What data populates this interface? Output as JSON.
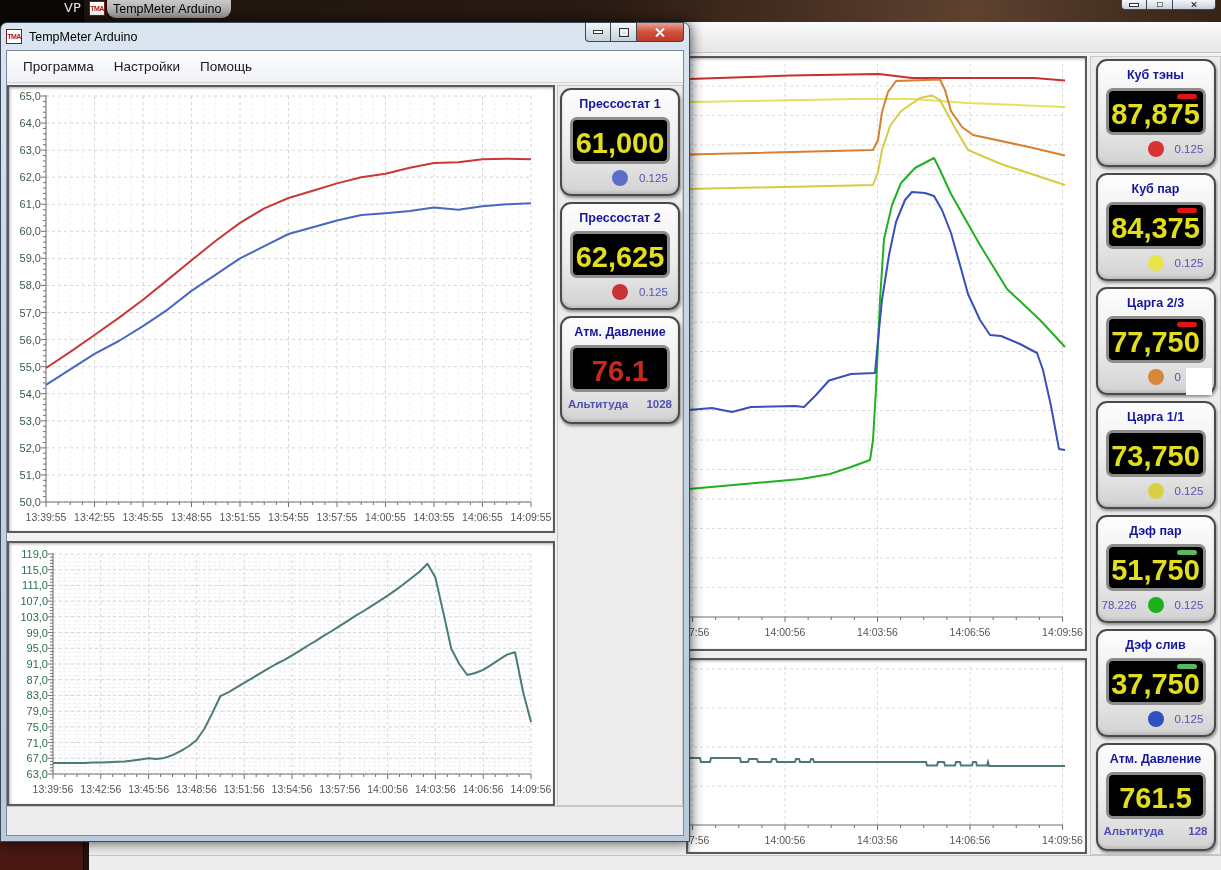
{
  "desktop": {
    "label": "VP"
  },
  "background_window": {
    "icon_text": "TMA",
    "title": "TempMeter Arduino",
    "upper_chart": {
      "x_labels": [
        "7:56",
        "14:00:56",
        "14:03:56",
        "14:06:56",
        "14:09:56"
      ]
    },
    "lower_chart": {
      "x_labels": [
        "7:56",
        "14:00:56",
        "14:03:56",
        "14:06:56",
        "14:09:56"
      ]
    },
    "gauges": [
      {
        "kind": "temperature",
        "title": "Куб тэны",
        "value": "87,875",
        "alarm": false,
        "indicator": {
          "color": "#e01414"
        },
        "color": "#d83232",
        "step": "0.125",
        "masked": false
      },
      {
        "kind": "temperature",
        "title": "Куб пар",
        "value": "84,375",
        "alarm": false,
        "indicator": {
          "color": "#e01414"
        },
        "color": "#e8e44a",
        "step": "0.125",
        "masked": false
      },
      {
        "kind": "temperature",
        "title": "Царга 2/3",
        "value": "77,750",
        "alarm": false,
        "indicator": {
          "color": "#e01414"
        },
        "color": "#d8863a",
        "step": "0",
        "masked": true
      },
      {
        "kind": "temperature",
        "title": "Царга 1/1",
        "value": "73,750",
        "alarm": false,
        "color": "#d8d044",
        "step": "0.125",
        "masked": false
      },
      {
        "kind": "temperature",
        "title": "Дэф пар",
        "value": "51,750",
        "alarm": false,
        "indicator": {
          "color": "#5cb85c"
        },
        "reading": "78.226",
        "color": "#1cb01c",
        "step": "0.125",
        "masked": false
      },
      {
        "kind": "temperature",
        "title": "Дэф слив",
        "value": "37,750",
        "alarm": false,
        "indicator": {
          "color": "#5cb85c"
        },
        "color": "#3050c0",
        "step": "0.125",
        "masked": false
      },
      {
        "kind": "pressure",
        "title": "Атм. Давление",
        "value": "761.5",
        "alarm": false,
        "caption": "Альтитуда",
        "altitude": "128"
      }
    ]
  },
  "window": {
    "icon_text": "TMA",
    "title": "TempMeter Arduino",
    "menu": [
      "Программа",
      "Настройки",
      "Помощь"
    ],
    "charts": [
      {
        "chart_data": {
          "type": "line",
          "grid": true,
          "categories": [
            "13:39:55",
            null,
            "13:42:55",
            null,
            "13:45:55",
            null,
            "13:48:55",
            null,
            "13:51:55",
            null,
            "13:54:55",
            null,
            "13:57:55",
            null,
            "14:00:55",
            null,
            "14:03:55",
            null,
            "14:06:55",
            null,
            "14:09:55"
          ],
          "ylim": [
            50,
            65
          ],
          "yticks": [
            {
              "value": 50,
              "label": "50,0"
            },
            {
              "value": 51,
              "label": "51,0"
            },
            {
              "value": 52,
              "label": "52,0"
            },
            {
              "value": 53,
              "label": "53,0"
            },
            {
              "value": 54,
              "label": "54,0"
            },
            {
              "value": 55,
              "label": "55,0"
            },
            {
              "value": 56,
              "label": "56,0"
            },
            {
              "value": 57,
              "label": "57,0"
            },
            {
              "value": 58,
              "label": "58,0"
            },
            {
              "value": 59,
              "label": "59,0"
            },
            {
              "value": 60,
              "label": "60,0"
            },
            {
              "value": 61,
              "label": "61,0"
            },
            {
              "value": 62,
              "label": "62,0"
            },
            {
              "value": 63,
              "label": "63,0"
            },
            {
              "value": 64,
              "label": "64,0"
            },
            {
              "value": 65,
              "label": "65,0"
            }
          ],
          "series": [
            {
              "color": "#c83838",
              "values": [
                54.95,
                55.55,
                56.17,
                56.8,
                57.47,
                58.2,
                58.93,
                59.65,
                60.31,
                60.85,
                61.23,
                61.5,
                61.77,
                62.0,
                62.13,
                62.35,
                62.53,
                62.55,
                62.66,
                62.68,
                62.66
              ]
            },
            {
              "color": "#4868c0",
              "values": [
                54.33,
                54.9,
                55.47,
                55.95,
                56.5,
                57.1,
                57.8,
                58.4,
                59.0,
                59.45,
                59.9,
                60.15,
                60.4,
                60.6,
                60.67,
                60.75,
                60.88,
                60.8,
                60.93,
                61.0,
                61.04
              ]
            }
          ]
        }
      },
      {
        "chart_data": {
          "type": "line",
          "grid": true,
          "categories": [
            "13:39:56",
            null,
            null,
            null,
            null,
            null,
            "13:42:56",
            null,
            null,
            null,
            null,
            null,
            "13:45:56",
            null,
            null,
            null,
            null,
            null,
            "13:48:56",
            null,
            null,
            null,
            null,
            null,
            "13:51:56",
            null,
            null,
            null,
            null,
            null,
            "13:54:56",
            null,
            null,
            null,
            null,
            null,
            "13:57:56",
            null,
            null,
            null,
            null,
            null,
            "14:00:56",
            null,
            null,
            null,
            null,
            null,
            "14:03:56",
            null,
            null,
            null,
            null,
            null,
            "14:06:56",
            null,
            null,
            null,
            null,
            null,
            "14:09:56"
          ],
          "ylim": [
            63,
            119
          ],
          "yticks": [
            {
              "value": 63,
              "label": "63,0"
            },
            {
              "value": 67,
              "label": "67,0"
            },
            {
              "value": 71,
              "label": "71,0"
            },
            {
              "value": 75,
              "label": "75,0"
            },
            {
              "value": 79,
              "label": "79,0"
            },
            {
              "value": 83,
              "label": "83,0"
            },
            {
              "value": 87,
              "label": "87,0"
            },
            {
              "value": 91,
              "label": "91,0"
            },
            {
              "value": 95,
              "label": "95,0"
            },
            {
              "value": 99,
              "label": "99,0"
            },
            {
              "value": 103,
              "label": "103,0"
            },
            {
              "value": 107,
              "label": "107,0"
            },
            {
              "value": 111,
              "label": "111,0"
            },
            {
              "value": 115,
              "label": "115,0"
            },
            {
              "value": 119,
              "label": "119,0"
            }
          ],
          "series": [
            {
              "color": "#4a7a7a",
              "values": [
                65.8,
                65.8,
                65.8,
                65.8,
                65.8,
                65.9,
                65.9,
                66.0,
                66.1,
                66.2,
                66.4,
                66.7,
                67.0,
                66.8,
                67.1,
                67.8,
                68.8,
                70.0,
                71.6,
                74.5,
                78.5,
                82.8,
                83.8,
                85.0,
                86.2,
                87.4,
                88.6,
                89.8,
                91.0,
                92.0,
                93.2,
                94.4,
                95.7,
                96.9,
                98.2,
                99.4,
                100.7,
                102.0,
                103.3,
                104.5,
                105.8,
                107.1,
                108.4,
                109.8,
                111.3,
                112.9,
                114.5,
                116.5,
                113.0,
                104.0,
                94.9,
                91.0,
                88.2,
                88.7,
                89.5,
                90.8,
                92.1,
                93.4,
                94.0,
                84.0,
                76.2
              ]
            }
          ]
        }
      }
    ],
    "gauges": [
      {
        "kind": "temperature",
        "title": "Прессостат 1",
        "value": "61,000",
        "alarm": false,
        "color": "#5a6ec8",
        "step": "0.125",
        "masked": false
      },
      {
        "kind": "temperature",
        "title": "Прессостат 2",
        "value": "62,625",
        "alarm": false,
        "color": "#c83434",
        "step": "0.125",
        "masked": false
      },
      {
        "kind": "pressure",
        "title": "Атм. Давление",
        "value": "76.1",
        "alarm": true,
        "caption": "Альтитуда",
        "altitude": "1028"
      }
    ]
  }
}
